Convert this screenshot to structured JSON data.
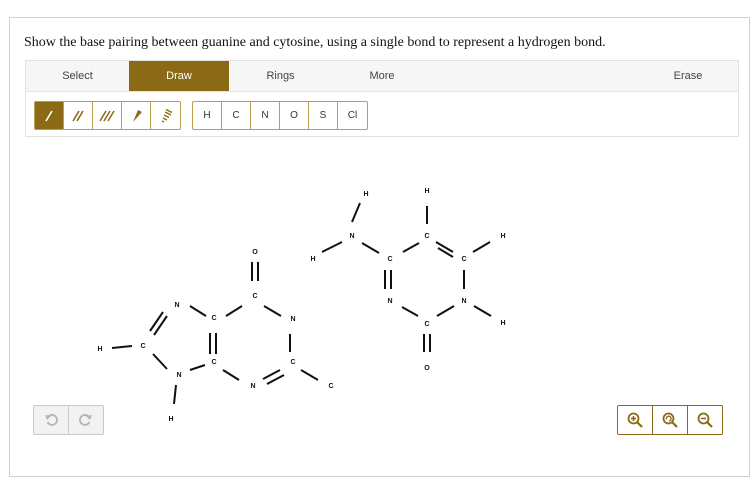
{
  "question": "Show the base pairing between guanine and cytosine, using a single bond to represent a hydrogen bond.",
  "tabs": [
    {
      "label": "Select",
      "active": false
    },
    {
      "label": "Draw",
      "active": true
    },
    {
      "label": "Rings",
      "active": false
    },
    {
      "label": "More",
      "active": false
    },
    {
      "label": "Erase",
      "active": false
    }
  ],
  "bond_tools": [
    {
      "icon": "single-bond-icon",
      "active": true
    },
    {
      "icon": "double-bond-icon",
      "active": false
    },
    {
      "icon": "triple-bond-icon",
      "active": false
    },
    {
      "icon": "wedge-bond-icon",
      "active": false
    },
    {
      "icon": "hash-bond-icon",
      "active": false
    }
  ],
  "atom_tools": [
    "H",
    "C",
    "N",
    "O",
    "S",
    "Cl"
  ],
  "molecule": {
    "atoms": [
      "H",
      "N",
      "H",
      "C",
      "C",
      "H",
      "C",
      "H",
      "N",
      "C",
      "H",
      "N",
      "C",
      "O",
      "O",
      "C",
      "N",
      "N",
      "C",
      "C",
      "H",
      "C",
      "C",
      "N",
      "N",
      "H",
      "H"
    ]
  },
  "accent_color": "#8a6a14"
}
